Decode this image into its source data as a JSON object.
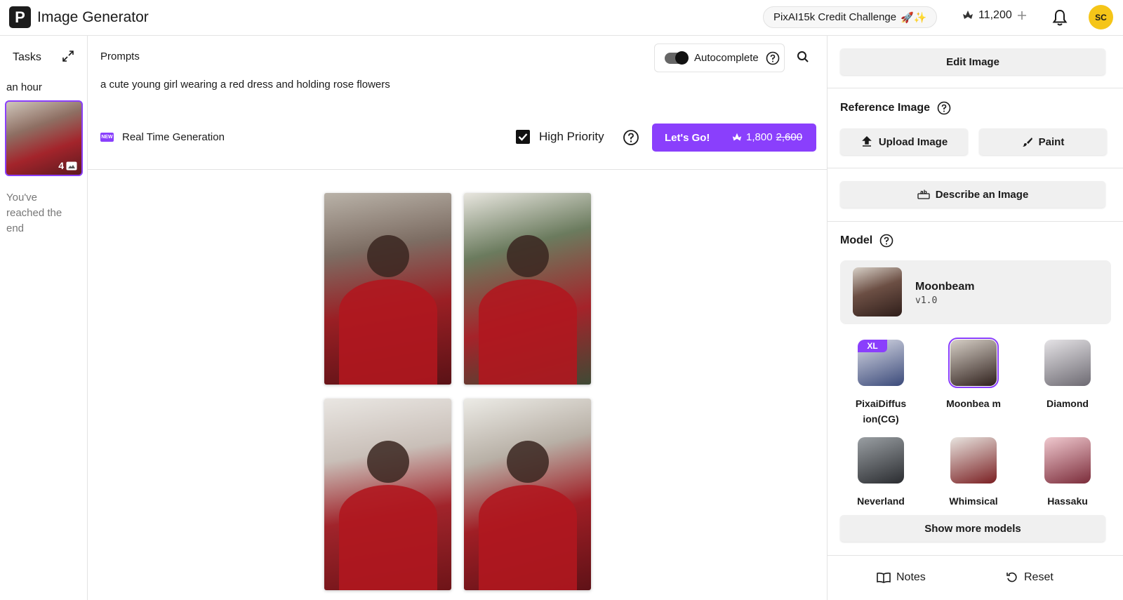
{
  "header": {
    "logo_letter": "P",
    "app_title": "Image Generator",
    "challenge_label": "PixAI15k Credit Challenge",
    "challenge_emoji": "🚀✨",
    "credits": "11,200",
    "avatar_initials": "SC"
  },
  "tasks": {
    "title": "Tasks",
    "time_label": "an hour",
    "task_count": "4",
    "end_text": "You've reached the end"
  },
  "prompt": {
    "label": "Prompts",
    "autocomplete_label": "Autocomplete",
    "text": "a cute young girl wearing a red dress and holding rose flowers",
    "new_badge": "NEW",
    "realtime_label": "Real Time Generation",
    "high_priority_label": "High Priority",
    "go_label": "Let's Go!",
    "go_cost": "1,800",
    "go_cost_original": "2,600"
  },
  "right_panel": {
    "edit_image": "Edit Image",
    "reference_title": "Reference Image",
    "upload_image": "Upload Image",
    "paint": "Paint",
    "describe_image": "Describe an Image",
    "model_title": "Model",
    "current_model": {
      "name": "Moonbeam",
      "version": "v1.0"
    },
    "models": [
      {
        "label": "PixaiDiffus ion(CG)",
        "badge": "XL",
        "colors": [
          "#d9dbe6",
          "#3b4a7a"
        ]
      },
      {
        "label": "Moonbea m",
        "badge": "",
        "colors": [
          "#d6cfc6",
          "#2f201c"
        ],
        "selected": true
      },
      {
        "label": "Diamond",
        "badge": "",
        "colors": [
          "#e5e3e6",
          "#6d6a72"
        ]
      },
      {
        "label": "Neverland",
        "badge": "",
        "colors": [
          "#9a9fa3",
          "#2a2c30"
        ]
      },
      {
        "label": "Whimsical",
        "badge": "",
        "colors": [
          "#e8e4df",
          "#7a1f22"
        ]
      },
      {
        "label": "Hassaku",
        "badge": "",
        "colors": [
          "#f0c9cf",
          "#7b2c3a"
        ]
      }
    ],
    "show_more": "Show more models",
    "notes": "Notes",
    "reset": "Reset"
  },
  "colors": {
    "accent": "#8a3ffc",
    "avatar": "#f5c518"
  }
}
